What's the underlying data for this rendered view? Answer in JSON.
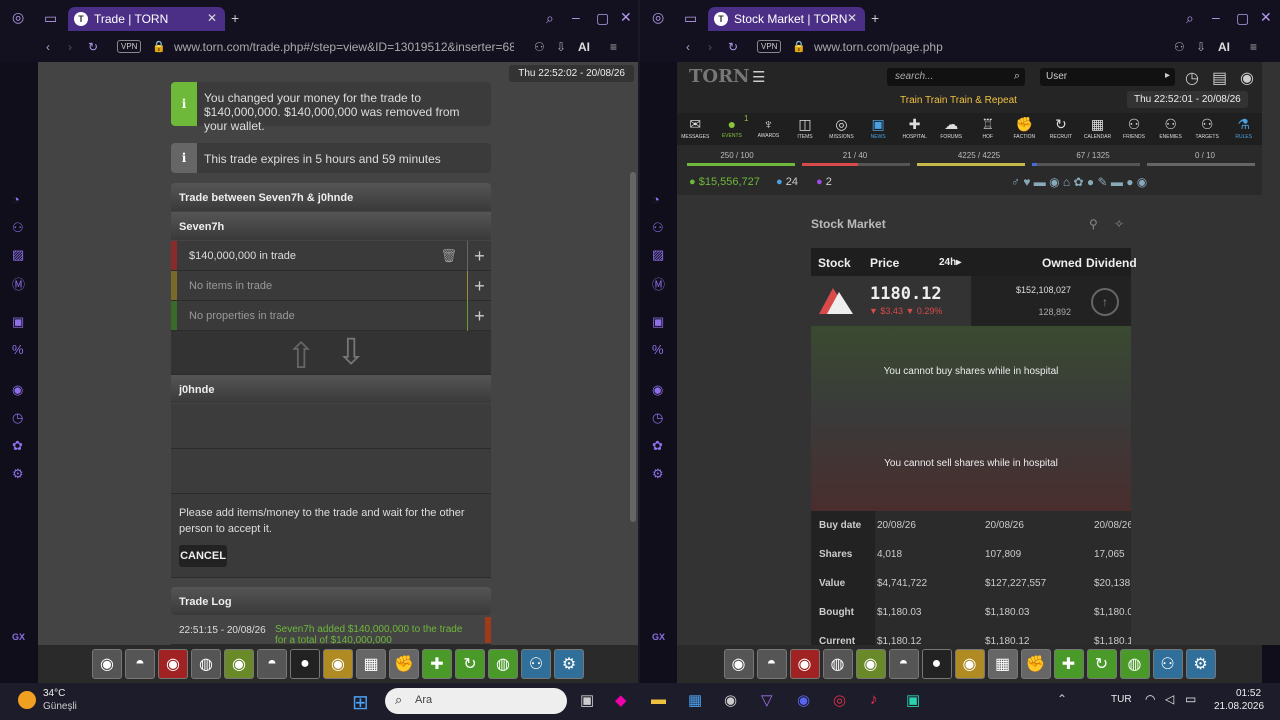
{
  "left": {
    "tab_title": "Trade | TORN",
    "url": "www.torn.com/trade.php#/step=view&ID=13019512&inserter=68",
    "timestamp": "Thu 22:52:02 - 20/08/26",
    "msg1": "You changed your money for the trade to $140,000,000. $140,000,000 was removed from your wallet.",
    "msg2": "This trade expires in 5 hours and 59 minutes",
    "trade_header": "Trade between Seven7h & j0hnde",
    "user1": "Seven7h",
    "user1_money": "$140,000,000 in trade",
    "user1_items": "No items in trade",
    "user1_props": "No properties in trade",
    "user2": "j0hnde",
    "instruction": "Please add items/money to the trade and wait for the other person to accept it.",
    "cancel": "CANCEL",
    "log_title": "Trade Log",
    "log_time": "22:51:15 - 20/08/26",
    "log_text": "Seven7h added $140,000,000 to the trade for a total of $140,000,000"
  },
  "right": {
    "tab_title": "Stock Market | TORN",
    "url": "www.torn.com/page.php",
    "logo": "TORN",
    "search_placeholder": "search...",
    "search_scope": "User",
    "promo": "Train Train Train & Repeat",
    "timestamp": "Thu 22:52:01 - 20/08/26",
    "icons": [
      "MESSAGES",
      "EVENTS",
      "AWARDS",
      "ITEMS",
      "MISSIONS",
      "NEWS",
      "HOSPITAL",
      "FORUMS",
      "HOF",
      "FACTION",
      "RECRUIT",
      "CALENDAR",
      "FRIENDS",
      "ENEMIES",
      "TARGETS",
      "RULES"
    ],
    "events_badge": "1",
    "energy": "250 / 100",
    "nerve": "21 / 40",
    "happy": "4225 / 4225",
    "life": "67 / 1325",
    "chain": "0 / 10",
    "money": "$15,556,727",
    "points": "24",
    "merits": "2",
    "page_title": "Stock Market",
    "cols": [
      "Stock",
      "Price",
      "24h",
      "Owned",
      "Dividend"
    ],
    "price": "1180.12",
    "change": "$3.43",
    "change_pct": "0.29%",
    "owned_value": "$152,108,027",
    "owned_shares": "128,892",
    "buy_msg": "You cannot buy shares while in hospital",
    "sell_msg": "You cannot sell shares while in hospital",
    "table_labels": [
      "Buy date",
      "Shares",
      "Value",
      "Bought",
      "Current"
    ],
    "table": [
      [
        "20/08/26",
        "4,018",
        "$4,741,722",
        "$1,180.03",
        "$1,180.12"
      ],
      [
        "20/08/26",
        "107,809",
        "$127,227,557",
        "$1,180.03",
        "$1,180.12"
      ],
      [
        "20/08/26",
        "17,065",
        "$20,138,",
        "$1,180.0",
        "$1,180.1"
      ]
    ]
  },
  "taskbar": {
    "temp": "34°C",
    "weather": "Güneşli",
    "search": "Ara",
    "lang": "TUR",
    "time": "01:52",
    "date": "21.08.2026"
  },
  "colors": {
    "accent": "#4b2f86",
    "red": "#d94a4a",
    "green": "#6eb83a"
  }
}
